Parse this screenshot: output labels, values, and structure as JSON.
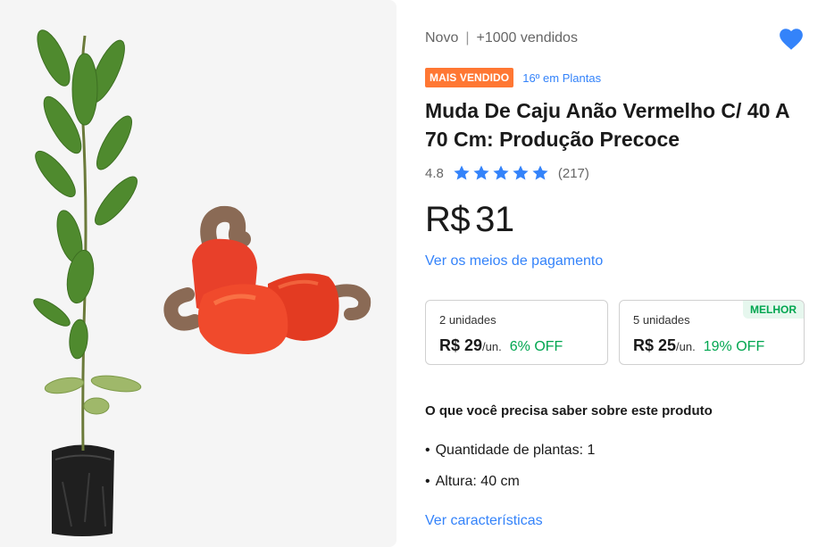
{
  "product": {
    "condition": "Novo",
    "separator": "|",
    "sold": "+1000 vendidos",
    "badge": "MAIS VENDIDO",
    "rank": "16º em Plantas",
    "title": "Muda De Caju Anão Vermelho C/ 40 A 70 Cm: Produção Precoce",
    "rating": "4.8",
    "stars": 4.8,
    "reviews": "(217)",
    "price_currency": "R$",
    "price_value": "31",
    "payment_link": "Ver os meios de pagamento"
  },
  "quantity_offers": [
    {
      "units": "2 unidades",
      "price": "R$ 29",
      "per": "/un.",
      "off": "6% OFF"
    },
    {
      "units": "5 unidades",
      "price": "R$ 25",
      "per": "/un.",
      "off": "19% OFF",
      "tag": "MELHOR"
    }
  ],
  "details": {
    "section_title": "O que você precisa saber sobre este produto",
    "features": [
      "Quantidade de plantas: 1",
      "Altura: 40 cm"
    ],
    "characteristics_link": "Ver características"
  },
  "icons": {
    "favorite": "heart-icon",
    "rating": "star-icon"
  },
  "colors": {
    "accent": "#3483fa",
    "badge": "#ff7733",
    "discount": "#00a650",
    "star": "#3483fa"
  }
}
